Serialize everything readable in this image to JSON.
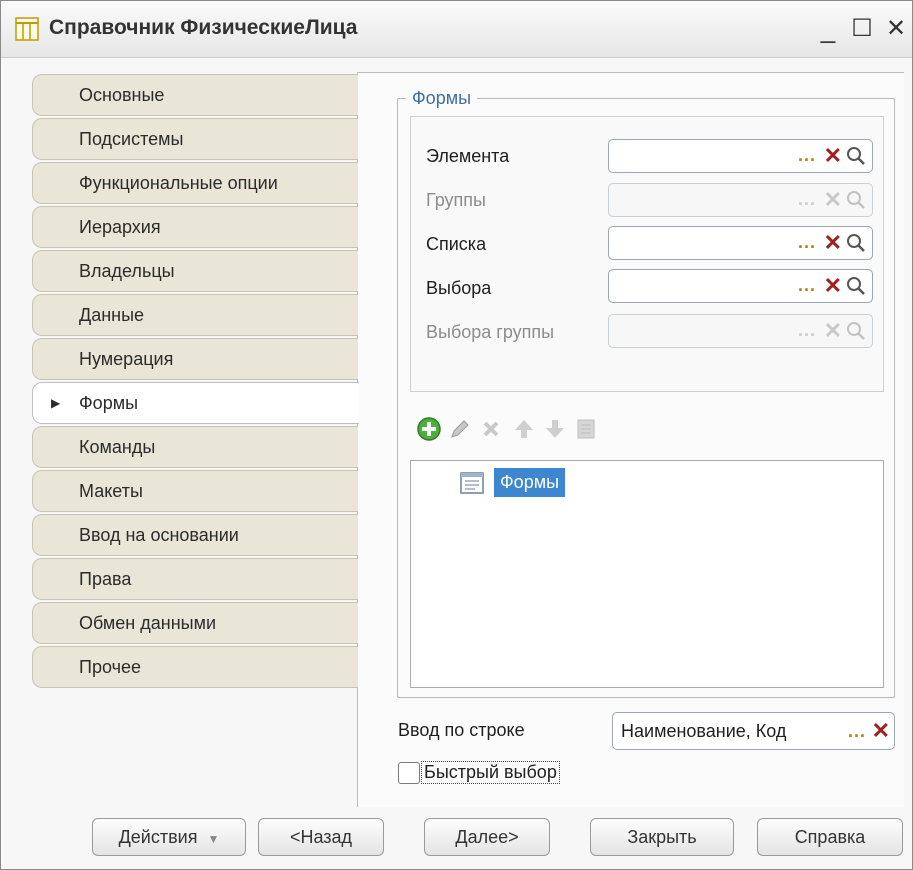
{
  "window": {
    "title": "Справочник ФизическиеЛица",
    "minimize": "_",
    "maximize": "☐",
    "close": "✕"
  },
  "tabs": [
    {
      "label": "Основные"
    },
    {
      "label": "Подсистемы"
    },
    {
      "label": "Функциональные опции"
    },
    {
      "label": "Иерархия"
    },
    {
      "label": "Владельцы"
    },
    {
      "label": "Данные"
    },
    {
      "label": "Нумерация"
    },
    {
      "label": "Формы",
      "active": true
    },
    {
      "label": "Команды"
    },
    {
      "label": "Макеты"
    },
    {
      "label": "Ввод на основании"
    },
    {
      "label": "Права"
    },
    {
      "label": "Обмен данными"
    },
    {
      "label": "Прочее"
    }
  ],
  "forms_group": {
    "title": "Формы",
    "rows": [
      {
        "label": "Элемента",
        "value": "",
        "enabled": true
      },
      {
        "label": "Группы",
        "value": "",
        "enabled": false
      },
      {
        "label": "Списка",
        "value": "",
        "enabled": true
      },
      {
        "label": "Выбора",
        "value": "",
        "enabled": true
      },
      {
        "label": "Выбора группы",
        "value": "",
        "enabled": false
      }
    ],
    "field_buttons": {
      "select": "...",
      "clear": "✕"
    },
    "toolbar_icons": [
      "add-icon",
      "edit-icon",
      "delete-icon",
      "move-up-icon",
      "move-down-icon",
      "list-icon"
    ],
    "tree_item": "Формы"
  },
  "input_by_string": {
    "label": "Ввод по строке",
    "value": "Наименование, Код",
    "select": "...",
    "clear": "✕"
  },
  "quick_choice": {
    "label": "Быстрый выбор",
    "checked": false
  },
  "buttons": {
    "actions": "Действия",
    "back": "<Назад",
    "next": "Далее>",
    "close": "Закрыть",
    "help": "Справка"
  },
  "colors": {
    "group_title": "#3f6ea6",
    "selection": "#3d87d1",
    "tab_bg": "#e9e6d8",
    "clear_button": "#a02020",
    "select_button": "#b08600"
  }
}
